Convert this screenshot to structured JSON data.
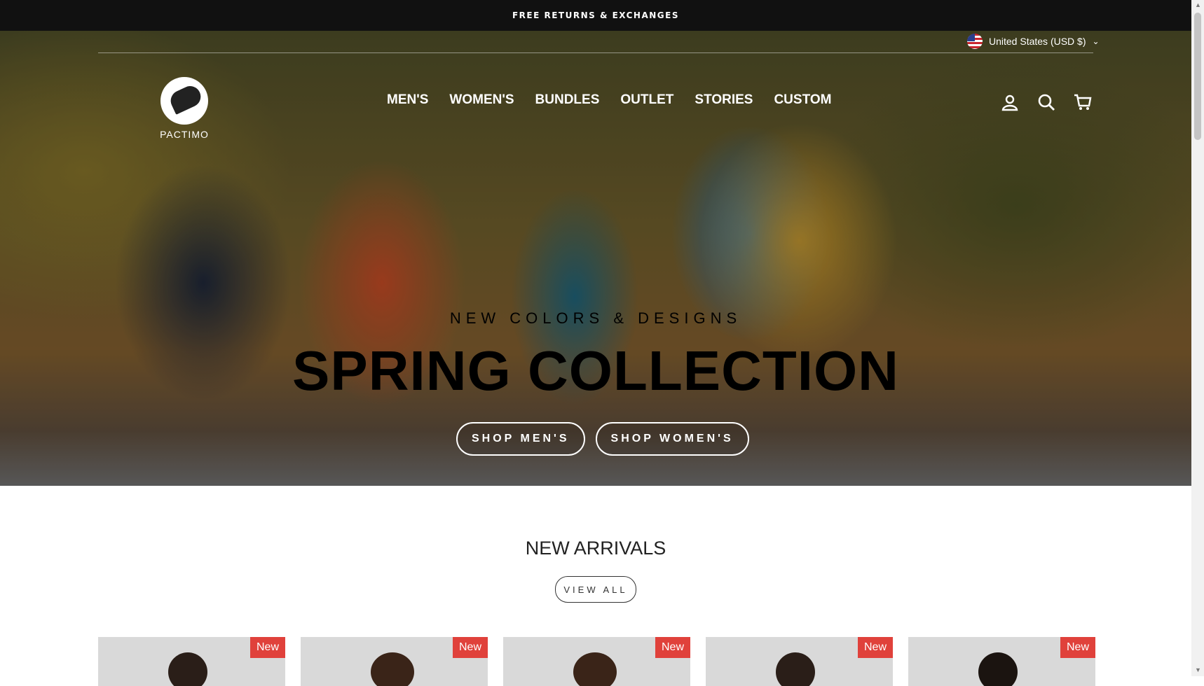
{
  "announcement": "FREE RETURNS & EXCHANGES",
  "locale": {
    "label": "United States (USD $)",
    "flag": "us-flag-icon"
  },
  "brand": {
    "name": "PACTIMO"
  },
  "nav": [
    {
      "label": "MEN'S"
    },
    {
      "label": "WOMEN'S"
    },
    {
      "label": "BUNDLES"
    },
    {
      "label": "OUTLET"
    },
    {
      "label": "STORIES"
    },
    {
      "label": "CUSTOM"
    }
  ],
  "header_icons": [
    "account-icon",
    "search-icon",
    "cart-icon"
  ],
  "hero": {
    "kicker": "NEW COLORS & DESIGNS",
    "headline": "SPRING COLLECTION",
    "buttons": [
      {
        "label": "SHOP MEN'S"
      },
      {
        "label": "SHOP WOMEN'S"
      }
    ]
  },
  "new_arrivals": {
    "title": "NEW ARRIVALS",
    "view_all": "VIEW ALL",
    "products": [
      {
        "badge": "New"
      },
      {
        "badge": "New"
      },
      {
        "badge": "New"
      },
      {
        "badge": "New"
      },
      {
        "badge": "New"
      }
    ]
  },
  "colors": {
    "announcement_bg": "#111111",
    "badge": "#e0413b"
  }
}
